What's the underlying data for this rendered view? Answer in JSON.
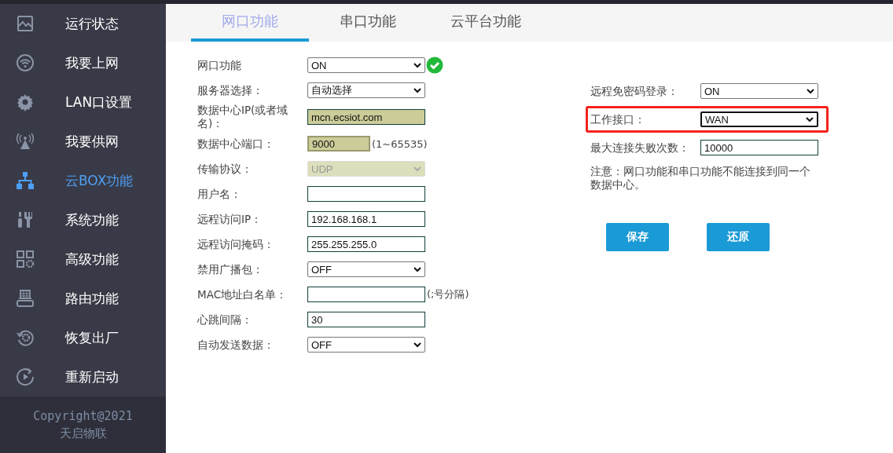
{
  "sidebar": {
    "items": [
      {
        "label": "运行状态",
        "selected": false
      },
      {
        "label": "我要上网",
        "selected": false
      },
      {
        "label": "LAN口设置",
        "selected": false
      },
      {
        "label": "我要供网",
        "selected": false
      },
      {
        "label": "云BOX功能",
        "selected": true
      },
      {
        "label": "系统功能",
        "selected": false
      },
      {
        "label": "高级功能",
        "selected": false
      },
      {
        "label": "路由功能",
        "selected": false
      },
      {
        "label": "恢复出厂",
        "selected": false
      },
      {
        "label": "重新启动",
        "selected": false
      }
    ],
    "footer": [
      "Copyright@2021",
      "天启物联"
    ]
  },
  "tabs": [
    {
      "label": "网口功能",
      "selected": true
    },
    {
      "label": "串口功能",
      "selected": false
    },
    {
      "label": "云平台功能",
      "selected": false
    }
  ],
  "left_fields": [
    {
      "label": "网口功能",
      "kind": "select",
      "value": "ON",
      "disabled": false,
      "autofilled": false,
      "valid": true
    },
    {
      "label": "服务器选择：",
      "kind": "select",
      "value": "自动选择",
      "disabled": false,
      "autofilled": false,
      "valid": false
    },
    {
      "label": "数据中心IP(或者域名)：",
      "kind": "input",
      "value": "mcn.ecsiot.com",
      "disabled": false,
      "autofilled": true,
      "valid": false
    },
    {
      "label": "数据中心端口：",
      "kind": "short",
      "value": "9000",
      "hint": "(1~65535)",
      "disabled": false,
      "autofilled": true,
      "valid": false
    },
    {
      "label": "传输协议：",
      "kind": "select",
      "value": "UDP",
      "disabled": true,
      "autofilled": false,
      "valid": false
    },
    {
      "label": "用户名：",
      "kind": "input",
      "disabled": false,
      "autofilled": false,
      "valid": false
    },
    {
      "label": "远程访问IP：",
      "kind": "input",
      "value": "192.168.168.1",
      "disabled": false,
      "autofilled": false,
      "valid": false
    },
    {
      "label": "远程访问掩码：",
      "kind": "input",
      "value": "255.255.255.0",
      "disabled": false,
      "autofilled": false,
      "valid": false
    },
    {
      "label": "禁用广播包：",
      "kind": "select",
      "value": "OFF",
      "disabled": false,
      "autofilled": false,
      "valid": false
    },
    {
      "label": "MAC地址白名单：",
      "kind": "input",
      "hint": "(;号分隔)",
      "disabled": false,
      "autofilled": false,
      "valid": false
    },
    {
      "label": "心跳间隔：",
      "kind": "input",
      "value": "30",
      "disabled": false,
      "autofilled": false,
      "valid": false
    },
    {
      "label": "自动发送数据：",
      "kind": "select",
      "value": "OFF",
      "disabled": false,
      "autofilled": false,
      "valid": false
    }
  ],
  "right_fields": [
    {
      "label": "远程免密码登录：",
      "kind": "select",
      "value": "ON",
      "highlighted": false
    },
    {
      "label": "工作接口：",
      "kind": "select",
      "value": "WAN",
      "highlighted": true
    },
    {
      "label": "最大连接失败次数：",
      "kind": "input",
      "value": "10000",
      "highlighted": false
    }
  ],
  "note": "注意：网口功能和串口功能不能连接到同一个数据中心。",
  "buttons": [
    "保存",
    "还原"
  ]
}
